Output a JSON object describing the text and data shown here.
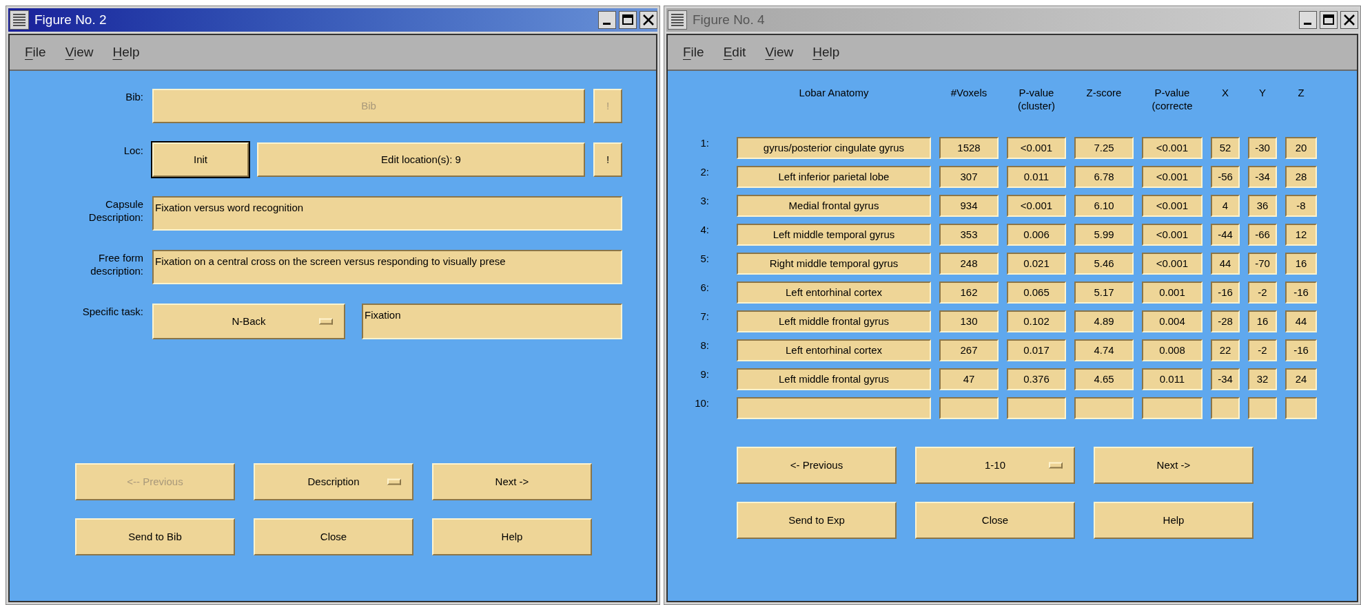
{
  "windows": [
    {
      "kind": "form",
      "title": "Figure No. 2",
      "active": true,
      "menu": [
        {
          "label": "File"
        },
        {
          "label": "View"
        },
        {
          "label": "Help"
        }
      ],
      "rows": [
        {
          "label": [
            "Bib:"
          ],
          "controls": [
            {
              "kind": "button",
              "label": "Bib",
              "disabled": true,
              "default": false
            },
            {
              "kind": "small_button",
              "label": "!",
              "disabled": true,
              "default": false
            }
          ]
        },
        {
          "label": [
            "Loc:"
          ],
          "controls": [
            {
              "kind": "short_button",
              "label": "Init",
              "disabled": false,
              "default": true
            },
            {
              "kind": "button",
              "label": "Edit location(s): 9",
              "disabled": false,
              "default": false
            },
            {
              "kind": "small_button",
              "label": "!",
              "disabled": false,
              "default": false
            }
          ]
        },
        {
          "label": [
            "Capsule",
            "Description:"
          ],
          "controls": [
            {
              "kind": "field",
              "value": "Fixation versus word recognition"
            }
          ]
        },
        {
          "label": [
            "Free form",
            "description:"
          ],
          "controls": [
            {
              "kind": "field",
              "value": "Fixation on a central cross on the screen versus responding to visually prese"
            }
          ]
        },
        {
          "label": [
            "Specific task:"
          ],
          "controls": [
            {
              "kind": "dropdown",
              "label": "N-Back",
              "disabled": false
            },
            {
              "kind": "field",
              "value": "Fixation"
            }
          ]
        }
      ],
      "buttons": [
        [
          {
            "kind": "button",
            "label": "<-- Previous",
            "disabled": true
          },
          {
            "kind": "dropdown",
            "label": "Description",
            "disabled": false
          },
          {
            "kind": "button",
            "label": "Next ->",
            "disabled": false
          }
        ],
        [
          {
            "kind": "button",
            "label": "Send to Bib",
            "disabled": false
          },
          {
            "kind": "button",
            "label": "Close",
            "disabled": false
          },
          {
            "kind": "button",
            "label": "Help",
            "disabled": false
          }
        ]
      ]
    },
    {
      "kind": "table",
      "title": "Figure No. 4",
      "active": false,
      "menu": [
        {
          "label": "File"
        },
        {
          "label": "Edit"
        },
        {
          "label": "View"
        },
        {
          "label": "Help"
        }
      ],
      "table": {
        "columns": [
          {
            "lines": [
              "Lobar Anatomy"
            ]
          },
          {
            "lines": [
              "#Voxels"
            ]
          },
          {
            "lines": [
              "P-value",
              "(cluster)"
            ]
          },
          {
            "lines": [
              "Z-score"
            ]
          },
          {
            "lines": [
              "P-value",
              "(correcte"
            ]
          },
          {
            "lines": [
              "X"
            ]
          },
          {
            "lines": [
              "Y"
            ]
          },
          {
            "lines": [
              "Z"
            ]
          }
        ],
        "rows": [
          {
            "number": "1:",
            "cells": [
              "gyrus/posterior cingulate gyrus",
              "1528",
              "<0.001",
              "7.25",
              "<0.001",
              "52",
              "-30",
              "20"
            ]
          },
          {
            "number": "2:",
            "cells": [
              "Left inferior parietal lobe",
              "307",
              "0.011",
              "6.78",
              "<0.001",
              "-56",
              "-34",
              "28"
            ]
          },
          {
            "number": "3:",
            "cells": [
              "Medial frontal gyrus",
              "934",
              "<0.001",
              "6.10",
              "<0.001",
              "4",
              "36",
              "-8"
            ]
          },
          {
            "number": "4:",
            "cells": [
              "Left middle temporal gyrus",
              "353",
              "0.006",
              "5.99",
              "<0.001",
              "-44",
              "-66",
              "12"
            ]
          },
          {
            "number": "5:",
            "cells": [
              "Right middle temporal gyrus",
              "248",
              "0.021",
              "5.46",
              "<0.001",
              "44",
              "-70",
              "16"
            ]
          },
          {
            "number": "6:",
            "cells": [
              "Left entorhinal cortex",
              "162",
              "0.065",
              "5.17",
              "0.001",
              "-16",
              "-2",
              "-16"
            ]
          },
          {
            "number": "7:",
            "cells": [
              "Left middle frontal gyrus",
              "130",
              "0.102",
              "4.89",
              "0.004",
              "-28",
              "16",
              "44"
            ]
          },
          {
            "number": "8:",
            "cells": [
              "Left entorhinal cortex",
              "267",
              "0.017",
              "4.74",
              "0.008",
              "22",
              "-2",
              "-16"
            ]
          },
          {
            "number": "9:",
            "cells": [
              "Left middle frontal gyrus",
              "47",
              "0.376",
              "4.65",
              "0.011",
              "-34",
              "32",
              "24"
            ]
          },
          {
            "number": "10:",
            "cells": []
          }
        ]
      },
      "buttons": [
        [
          {
            "kind": "button",
            "label": "<- Previous",
            "disabled": false
          },
          {
            "kind": "dropdown",
            "label": "1-10",
            "disabled": false
          },
          {
            "kind": "button",
            "label": "Next ->",
            "disabled": false
          }
        ],
        [
          {
            "kind": "button",
            "label": "Send to Exp",
            "disabled": false
          },
          {
            "kind": "button",
            "label": "Close",
            "disabled": false
          },
          {
            "kind": "button",
            "label": "Help",
            "disabled": false
          }
        ]
      ]
    }
  ]
}
